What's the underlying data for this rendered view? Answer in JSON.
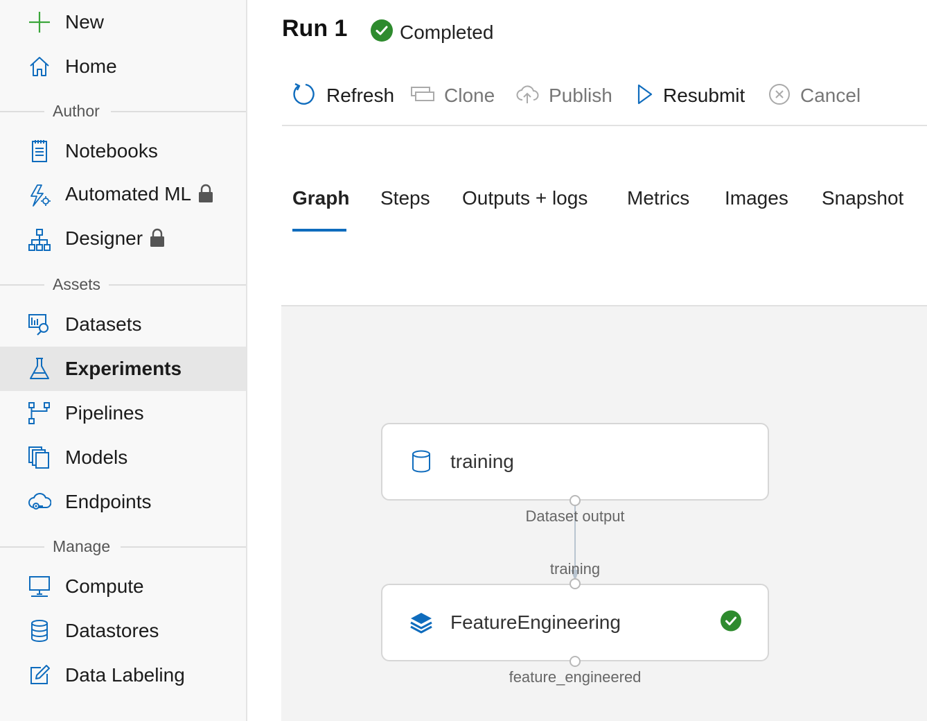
{
  "sidebar": {
    "new": "New",
    "home": "Home",
    "sections": {
      "author": "Author",
      "assets": "Assets",
      "manage": "Manage"
    },
    "author_items": [
      {
        "label": "Notebooks"
      },
      {
        "label": "Automated ML",
        "locked": true
      },
      {
        "label": "Designer",
        "locked": true
      }
    ],
    "asset_items": [
      {
        "label": "Datasets"
      },
      {
        "label": "Experiments",
        "active": true
      },
      {
        "label": "Pipelines"
      },
      {
        "label": "Models"
      },
      {
        "label": "Endpoints"
      }
    ],
    "manage_items": [
      {
        "label": "Compute"
      },
      {
        "label": "Datastores"
      },
      {
        "label": "Data Labeling"
      }
    ]
  },
  "header": {
    "title": "Run 1",
    "status": "Completed"
  },
  "toolbar": {
    "refresh": "Refresh",
    "clone": "Clone",
    "publish": "Publish",
    "resubmit": "Resubmit",
    "cancel": "Cancel"
  },
  "tabs": [
    {
      "label": "Graph",
      "active": true
    },
    {
      "label": "Steps"
    },
    {
      "label": "Outputs + logs"
    },
    {
      "label": "Metrics"
    },
    {
      "label": "Images"
    },
    {
      "label": "Snapshot"
    }
  ],
  "graph": {
    "dataset_node": {
      "label": "training",
      "icon": "cylinder-icon"
    },
    "dataset_output": "Dataset output",
    "step_input": "training",
    "step_node": {
      "label": "FeatureEngineering",
      "icon": "layers-icon",
      "status": "completed"
    },
    "step_output": "feature_engineered"
  },
  "colors": {
    "accent": "#0f6cbd",
    "success": "#2e8b2e",
    "active_bg": "#e6e6e6"
  }
}
